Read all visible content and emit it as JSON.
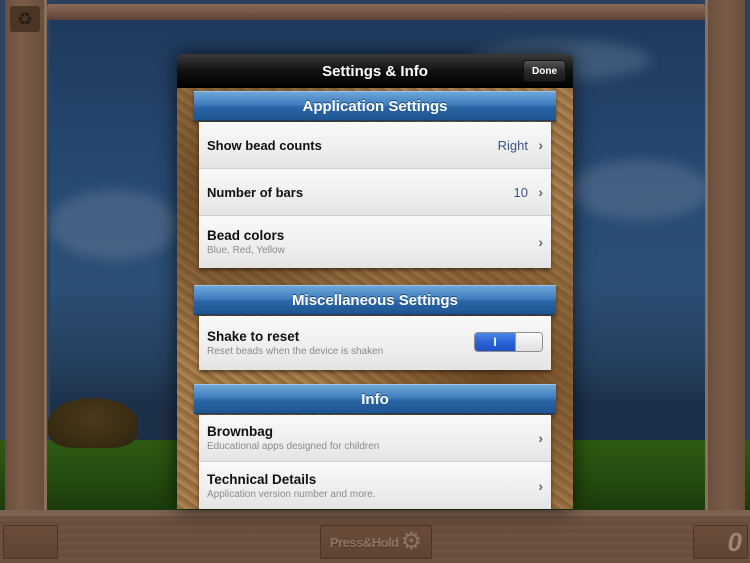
{
  "background": {
    "press_hold_label": "Press&Hold",
    "counter_value": "0"
  },
  "modal": {
    "title": "Settings & Info",
    "done_label": "Done",
    "sections": [
      {
        "title": "Application Settings",
        "rows": [
          {
            "title": "Show bead counts",
            "value": "Right"
          },
          {
            "title": "Number of bars",
            "value": "10"
          },
          {
            "title": "Bead colors",
            "subtitle": "Blue, Red, Yellow"
          }
        ]
      },
      {
        "title": "Miscellaneous Settings",
        "rows": [
          {
            "title": "Shake to reset",
            "subtitle": "Reset beads when the device is shaken",
            "toggle_on": true,
            "toggle_label": "I"
          }
        ]
      },
      {
        "title": "Info",
        "rows": [
          {
            "title": "Brownbag",
            "subtitle": "Educational apps designed for children"
          },
          {
            "title": "Technical Details",
            "subtitle": "Application version number and more."
          }
        ]
      }
    ]
  },
  "colors": {
    "section_header_blue": "#2a65a6",
    "value_text_blue": "#3d5487",
    "toggle_on_blue": "#2a64d8"
  }
}
